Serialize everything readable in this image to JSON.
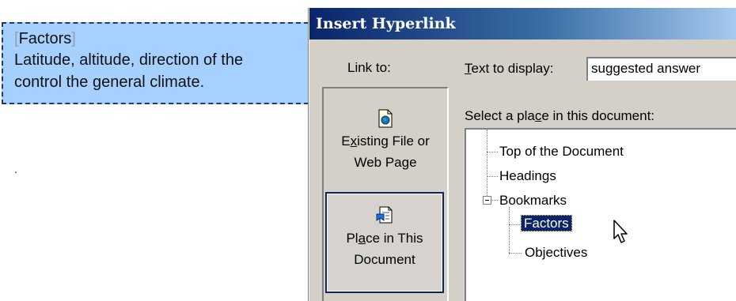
{
  "document": {
    "textbox": {
      "heading": "Factors",
      "body_line1": "Latitude, altitude, direction of the",
      "body_line2": "control the general climate."
    },
    "stray_mark": "."
  },
  "dialog": {
    "title": "Insert Hyperlink",
    "link_to_label": "Link to:",
    "places": {
      "existing": {
        "pre": "E",
        "mnemonic": "x",
        "post": "isting File or",
        "line2": "Web Page"
      },
      "this_document": {
        "pre": "Pl",
        "mnemonic": "a",
        "post": "ce in This",
        "line2": "Document"
      }
    },
    "text_to_display": {
      "mnemonic": "T",
      "rest": "ext to display:",
      "value": "suggested answer"
    },
    "select_place": {
      "pre": "Select a pla",
      "mnemonic": "c",
      "post": "e in this document:"
    },
    "tree": {
      "top": "Top of the Document",
      "headings": "Headings",
      "bookmarks": "Bookmarks",
      "bookmark_items": [
        "Factors",
        "Objectives"
      ],
      "selected": "Factors"
    }
  },
  "colors": {
    "titlebar_start": "#0a246a",
    "titlebar_end": "#a6caf0",
    "textbox_bg": "#a6d0ff",
    "dialog_bg": "#d4d0c8",
    "selection": "#0a246a"
  },
  "icons": {
    "existing_file": "document-globe-icon",
    "this_document": "document-bookmark-icon",
    "pointer": "mouse-pointer-icon"
  }
}
